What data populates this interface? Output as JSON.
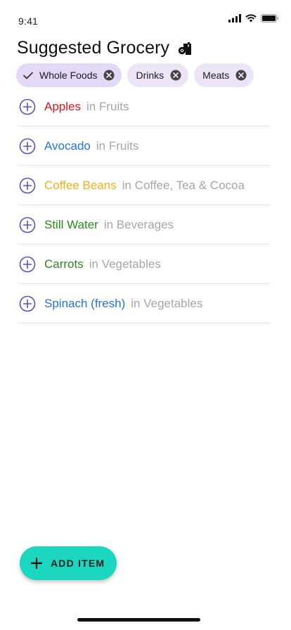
{
  "status": {
    "time": "9:41"
  },
  "header": {
    "title": "Suggested Grocery",
    "icon": "grocery-bag-icon"
  },
  "chips": [
    {
      "label": "Whole Foods",
      "selected": true
    },
    {
      "label": "Drinks",
      "selected": false
    },
    {
      "label": "Meats",
      "selected": false
    }
  ],
  "items": [
    {
      "name": "Apples",
      "category": "in Fruits",
      "color": "#e8131b"
    },
    {
      "name": "Avocado",
      "category": "in Fruits",
      "color": "#2674d9"
    },
    {
      "name": "Coffee Beans",
      "category": "in Coffee, Tea & Cocoa",
      "color": "#f3b01b"
    },
    {
      "name": "Still Water",
      "category": "in Beverages",
      "color": "#2a8a1d"
    },
    {
      "name": "Carrots",
      "category": "in Vegetables",
      "color": "#2a8a1d"
    },
    {
      "name": "Spinach (fresh)",
      "category": "in Vegetables",
      "color": "#2674d9"
    }
  ],
  "fab": {
    "label": "ADD ITEM"
  },
  "colors": {
    "accent": "#1cd7c0",
    "chip": "#ece5f7",
    "add_icon": "#5a4fc8"
  }
}
